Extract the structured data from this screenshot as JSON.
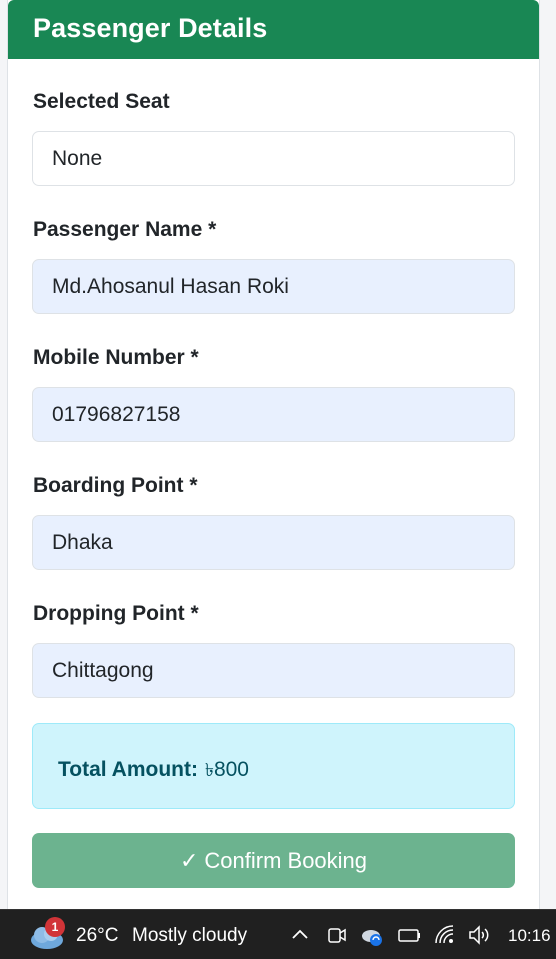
{
  "header": {
    "title": "Passenger Details"
  },
  "form": {
    "selected_seat": {
      "label": "Selected Seat",
      "value": "None"
    },
    "passenger_name": {
      "label": "Passenger Name *",
      "value": "Md.Ahosanul Hasan Roki"
    },
    "mobile_number": {
      "label": "Mobile Number *",
      "value": "01796827158"
    },
    "boarding_point": {
      "label": "Boarding Point *",
      "value": "Dhaka"
    },
    "dropping_point": {
      "label": "Dropping Point *",
      "value": "Chittagong"
    }
  },
  "total": {
    "label": "Total Amount:",
    "currency": "৳",
    "amount": "800"
  },
  "confirm_button": {
    "check": "✓",
    "label": "Confirm Booking"
  },
  "taskbar": {
    "notification_count": "1",
    "temperature": "26°C",
    "condition": "Mostly cloudy",
    "time": "10:16"
  },
  "colors": {
    "header_bg": "#198754",
    "confirm_bg": "#6cb38f",
    "alert_bg": "#cff4fc",
    "alert_text": "#055160",
    "autofill_bg": "#e8f0fe"
  }
}
